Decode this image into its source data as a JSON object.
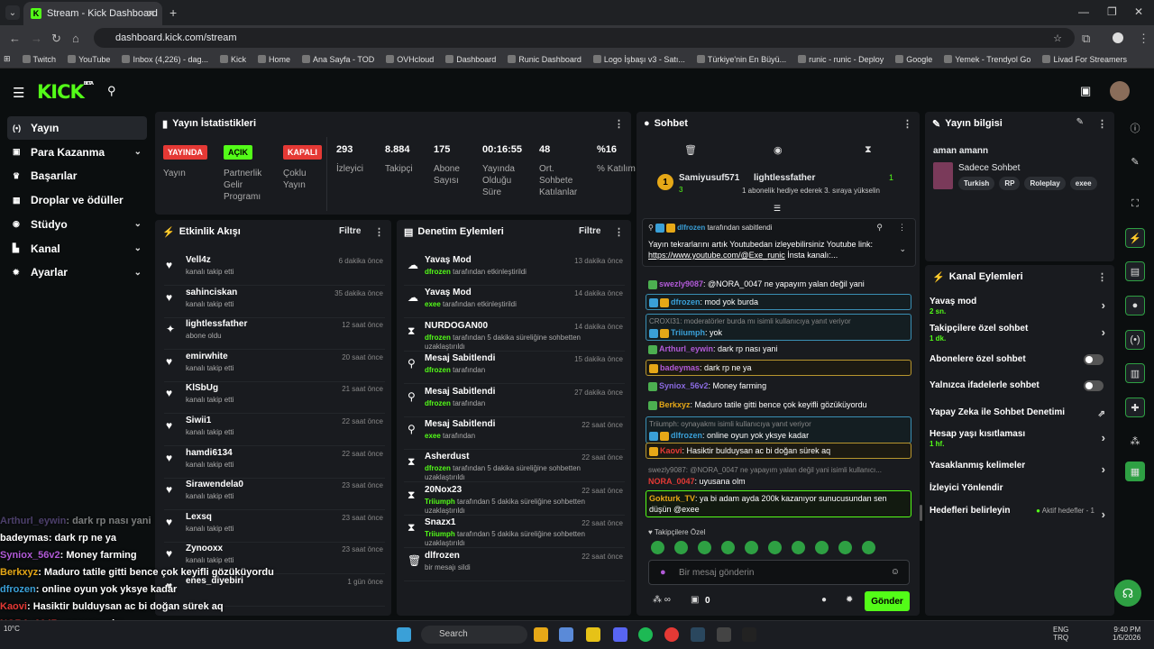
{
  "browser": {
    "tab_title": "Stream - Kick Dashboard",
    "url": "dashboard.kick.com/stream",
    "bookmarks": [
      "Twitch",
      "YouTube",
      "Inbox (4,226) - dag...",
      "Kick",
      "Home",
      "Ana Sayfa - TOD",
      "OVHcloud",
      "Dashboard",
      "Runic Dashboard",
      "Logo İşbaşı v3 - Satı...",
      "Türkiye'nin En Büyü...",
      "runic - runic - Deploy",
      "Google",
      "Yemek - Trendyol Go",
      "Livad For Streamers"
    ]
  },
  "app": {
    "logo": "KICK",
    "beta": "BETA"
  },
  "sidebar": {
    "items": [
      {
        "label": "Yayın",
        "icon": "broadcast-icon",
        "active": true,
        "chevron": false
      },
      {
        "label": "Para Kazanma",
        "icon": "money-icon",
        "chevron": true
      },
      {
        "label": "Başarılar",
        "icon": "trophy-icon",
        "chevron": false
      },
      {
        "label": "Droplar ve ödüller",
        "icon": "gift-icon",
        "chevron": false
      },
      {
        "label": "Stüdyo",
        "icon": "studio-icon",
        "chevron": true
      },
      {
        "label": "Kanal",
        "icon": "channel-icon",
        "chevron": true
      },
      {
        "label": "Ayarlar",
        "icon": "gear-icon",
        "chevron": true
      }
    ]
  },
  "stats_panel": {
    "title": "Yayın İstatistikleri",
    "badges": [
      {
        "text": "YAYINDA",
        "label": "Yayın",
        "color": "#e53935"
      },
      {
        "text": "AÇIK",
        "label": "Partnerlik Gelir Programı",
        "color": "#53fc18"
      },
      {
        "text": "KAPALI",
        "label": "Çoklu Yayın",
        "color": "#e53935"
      }
    ],
    "stats": [
      {
        "value": "293",
        "label": "İzleyici"
      },
      {
        "value": "8.884",
        "label": "Takipçi"
      },
      {
        "value": "175",
        "label": "Abone Sayısı"
      },
      {
        "value": "00:16:55",
        "label": "Yayında Olduğu Süre"
      },
      {
        "value": "48",
        "label": "Ort. Sohbete Katılanlar"
      },
      {
        "value": "%16",
        "label": "% Katılım"
      }
    ]
  },
  "activity": {
    "title": "Etkinlik Akışı",
    "filter": "Filtre",
    "rows": [
      {
        "name": "Vell4z",
        "sub": "kanalı takip etti",
        "time": "6 dakika önce"
      },
      {
        "name": "sahinciskan",
        "sub": "kanalı takip etti",
        "time": "35 dakika önce"
      },
      {
        "name": "lightlessfather",
        "sub": "abone oldu",
        "time": "12 saat önce"
      },
      {
        "name": "emirwhite",
        "sub": "kanalı takip etti",
        "time": "20 saat önce"
      },
      {
        "name": "KlSbUg",
        "sub": "kanalı takip etti",
        "time": "21 saat önce"
      },
      {
        "name": "Siwii1",
        "sub": "kanalı takip etti",
        "time": "22 saat önce"
      },
      {
        "name": "hamdi6134",
        "sub": "kanalı takip etti",
        "time": "22 saat önce"
      },
      {
        "name": "Sirawendela0",
        "sub": "kanalı takip etti",
        "time": "23 saat önce"
      },
      {
        "name": "Lexsq",
        "sub": "kanalı takip etti",
        "time": "23 saat önce"
      },
      {
        "name": "Zynooxx",
        "sub": "kanalı takip etti",
        "time": "23 saat önce"
      },
      {
        "name": "enes_diyebiri",
        "sub": "",
        "time": "1 gün önce"
      }
    ]
  },
  "moderation": {
    "title": "Denetim Eylemleri",
    "filter": "Filtre",
    "rows": [
      {
        "name": "Yavaş Mod",
        "who": "dfrozen",
        "rest": "tarafından etkinleştirildi",
        "time": "13 dakika önce"
      },
      {
        "name": "Yavaş Mod",
        "who": "exee",
        "rest": "tarafından etkinleştirildi",
        "time": "14 dakika önce"
      },
      {
        "name": "NURDOGAN00",
        "who": "dfrozen",
        "rest": "tarafından 5 dakika süreliğine sohbetten uzaklaştırıldı",
        "time": "14 dakika önce"
      },
      {
        "name": "Mesaj Sabitlendi",
        "who": "dfrozen",
        "rest": "tarafından",
        "time": "15 dakika önce"
      },
      {
        "name": "Mesaj Sabitlendi",
        "who": "dfrozen",
        "rest": "tarafından",
        "time": "27 dakika önce"
      },
      {
        "name": "Mesaj Sabitlendi",
        "who": "exee",
        "rest": "tarafından",
        "time": "22 saat önce"
      },
      {
        "name": "Asherdust",
        "who": "dfrozen",
        "rest": "tarafından 5 dakika süreliğine sohbetten uzaklaştırıldı",
        "time": "22 saat önce"
      },
      {
        "name": "20Nox23",
        "who": "Triiumph",
        "rest": "tarafından 5 dakika süreliğine sohbetten uzaklaştırıldı",
        "time": "22 saat önce"
      },
      {
        "name": "Snazx1",
        "who": "Triiumph",
        "rest": "tarafından 5 dakika süreliğine sohbetten uzaklaştırıldı",
        "time": "22 saat önce"
      },
      {
        "name": "dlfrozen",
        "who": "",
        "rest": "bir mesajı sildi",
        "time": "22 saat önce"
      }
    ]
  },
  "chat": {
    "title": "Sohbet",
    "leader1": {
      "name": "Samiyusuf571",
      "count": "3",
      "rank": "1"
    },
    "leader2": {
      "name": "lightlessfather",
      "count": "1",
      "note": "1 abonelik hediye ederek 3. sıraya yükselin"
    },
    "pinned": {
      "by": "dlfrozen",
      "byline": "tarafından sabitlendi",
      "text": "Yayın tekrarlarını artık Youtubedan izleyebilirsiniz Youtube link: ",
      "link": "https://www.youtube.com/@Exe_runic",
      "tail": " İnsta kanalı:..."
    },
    "messages": [
      {
        "user": "swezly9087",
        "color": "#b25ad8",
        "text": ": @NORA_0047 ne yapayım yalan değil yani"
      },
      {
        "user": "dfrozen",
        "color": "#3aa0d8",
        "text": ": mod yok burda",
        "hl": "blue"
      },
      {
        "reply": "CROXI31: moderatörler burda mı isimli kullanıcıya yanıt veriyor",
        "user": "Triiumph",
        "color": "#3aa0d8",
        "text": ": yok",
        "hl": "blue"
      },
      {
        "user": "Arthurl_eywin",
        "color": "#b25ad8",
        "text": ": dark rp nası yani"
      },
      {
        "user": "badeymas",
        "color": "#b25ad8",
        "text": ": dark rp ne ya",
        "hl": "gold"
      },
      {
        "user": "Syniox_56v2",
        "color": "#8a6ae0",
        "text": ": Money farming"
      },
      {
        "user": "Berkxyz",
        "color": "#e6a817",
        "text": ": Maduro tatile gitti bence çok keyifli gözüküyordu"
      },
      {
        "reply": "Triiumph: oynayakmı isimli kullanıcıya yanıt veriyor",
        "user": "dlfrozen",
        "color": "#3aa0d8",
        "text": ": online oyun yok yksye kadar",
        "hl": "blue"
      },
      {
        "user": "Kaovi",
        "color": "#e53935",
        "text": ": Hasiktir bulduysan ac bi doğan sürek aq",
        "hl": "gold"
      },
      {
        "reply": "swezly9087: @NORA_0047 ne yapayım yalan değil yani isimli kullanıcı...",
        "user": "NORA_0047",
        "color": "#e53935",
        "text": ": uyusana olm"
      },
      {
        "user": "Gokturk_TV",
        "color": "#e6a817",
        "text": ": ya bi adam ayda 200k kazanıyor sunucusundan sen düşün @exee",
        "hl": "green"
      }
    ],
    "emote_label": "Takipçilere Özel",
    "input_placeholder": "Bir mesaj gönderin",
    "viewer_count": "0",
    "send_label": "Gönder"
  },
  "stream_info": {
    "title": "Yayın bilgisi",
    "stream_title": "aman amann",
    "category": "Sadece Sohbet",
    "tags": [
      "Turkish",
      "RP",
      "Roleplay",
      "exee"
    ]
  },
  "channel_actions": {
    "title": "Kanal Eylemleri",
    "rows": [
      {
        "label": "Yavaş mod",
        "sub": "2 sn.",
        "kind": "arrow"
      },
      {
        "label": "Takipçilere özel sohbet",
        "sub": "1 dk.",
        "kind": "arrow"
      },
      {
        "label": "Abonelere özel sohbet",
        "sub": "",
        "kind": "toggle"
      },
      {
        "label": "Yalnızca ifadelerle sohbet",
        "sub": "",
        "kind": "toggle"
      },
      {
        "label": "Yapay Zeka ile Sohbet Denetimi",
        "sub": "",
        "kind": "ext"
      },
      {
        "label": "Hesap yaşı kısıtlaması",
        "sub": "1 hf.",
        "kind": "arrow"
      },
      {
        "label": "Yasaklanmış kelimeler",
        "sub": "",
        "kind": "arrow"
      },
      {
        "label": "İzleyici Yönlendir",
        "sub": "",
        "kind": "none"
      },
      {
        "label": "Hedefleri belirleyin",
        "sub": "",
        "kind": "goal",
        "extra": "Aktif hedefler - 1"
      }
    ]
  },
  "overlay": [
    {
      "user": "Arthurl_eywin",
      "text": ": dark rp nası yani",
      "color": "#9a7ad8"
    },
    {
      "user": "badeymas",
      "text": ": dark rp ne ya",
      "color": "#ffffff"
    },
    {
      "user": "Syniox_56v2",
      "text": ": Money farming",
      "color": "#b25ad8"
    },
    {
      "user": "Berkxyz",
      "text": ": Maduro tatile gitti bence çok keyifli gözüküyordu",
      "color": "#e6a817"
    },
    {
      "user": "dfrozen",
      "text": ": online oyun yok yksye kadar",
      "color": "#3aa0d8"
    },
    {
      "user": "Kaovi",
      "text": ": Hasiktir bulduysan ac bi doğan sürek aq",
      "color": "#e53935"
    },
    {
      "user": "NORA_0047",
      "text": ": uyusana olm",
      "color": "#e53935"
    },
    {
      "user": "Gokturk_TV",
      "text": ": ya bi adam ayda 200k kazanıyor sunucusundan sen düşün @exee",
      "color": "#e6a817"
    }
  ],
  "taskbar": {
    "search": "Search",
    "lang1": "ENG",
    "lang2": "TRQ",
    "time": "9:40 PM",
    "date": "1/5/2026",
    "weather": "10°C"
  }
}
